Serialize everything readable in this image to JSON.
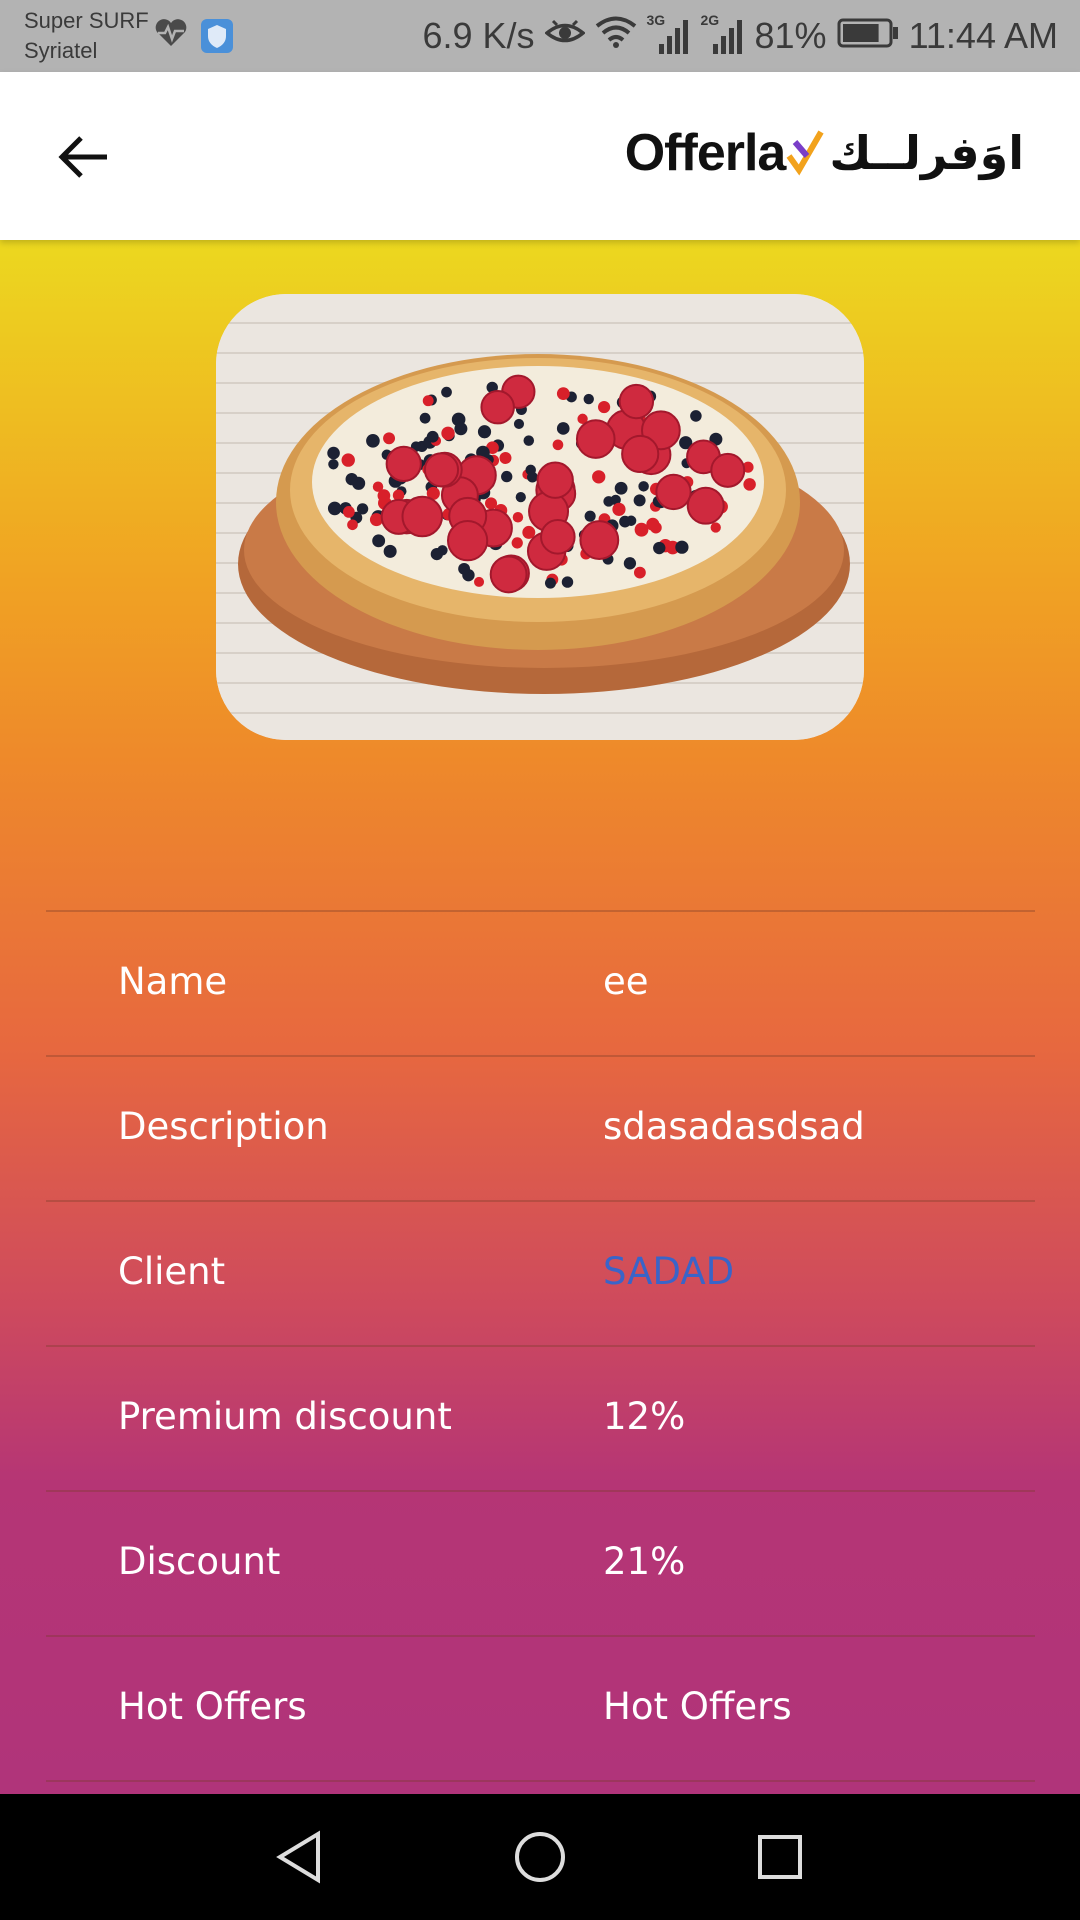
{
  "status_bar": {
    "carrier_line1": "Super SURF",
    "carrier_line2": "Syriatel",
    "net_speed": "6.9 K/s",
    "net_3g": "3G",
    "net_2g": "2G",
    "battery": "81%",
    "battery_level": 0.81,
    "time": "11:44 AM",
    "icons": [
      "heart-monitor-icon",
      "shield-icon",
      "eye-icon",
      "wifi-icon",
      "signal-icon",
      "battery-icon"
    ]
  },
  "app_bar": {
    "back_icon": "arrow-left-icon",
    "logo_latin": "Offerla",
    "logo_arabic": "اوَفرلــك"
  },
  "details": [
    {
      "label": "Name",
      "value": "ee"
    },
    {
      "label": "Description",
      "value": "sdasadasdsad"
    },
    {
      "label": "Client",
      "value": "SADAD"
    },
    {
      "label": "Premium discount",
      "value": "12%"
    },
    {
      "label": "Discount",
      "value": "21%"
    },
    {
      "label": "Hot Offers",
      "value": "Hot Offers"
    }
  ],
  "nav_bar": {
    "icons": [
      "back-triangle-icon",
      "home-circle-icon",
      "recents-square-icon"
    ]
  },
  "colors": {
    "gradient_top": "#ecd81f",
    "gradient_mid": "#ee8a2a",
    "gradient_bottom": "#b0347a",
    "link": "#3a64c8"
  }
}
